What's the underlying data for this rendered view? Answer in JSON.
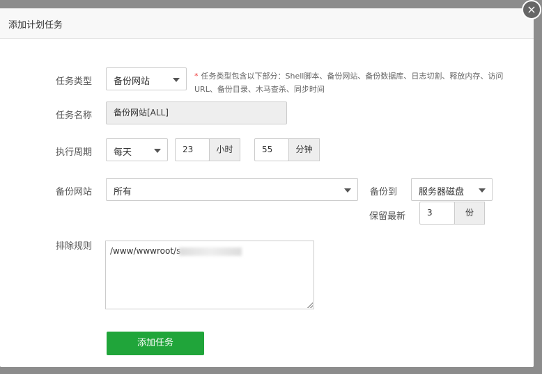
{
  "dialog": {
    "title": "添加计划任务",
    "close_symbol": "×"
  },
  "form": {
    "task_type": {
      "label": "任务类型",
      "selected": "备份网站",
      "hint": "任务类型包含以下部分：Shell脚本、备份网站、备份数据库、日志切割、释放内存、访问URL、备份目录、木马查杀、同步时间",
      "hint_mark": "*"
    },
    "task_name": {
      "label": "任务名称",
      "value": "备份网站[ALL]"
    },
    "period": {
      "label": "执行周期",
      "selected": "每天",
      "hour_value": "23",
      "hour_unit": "小时",
      "minute_value": "55",
      "minute_unit": "分钟"
    },
    "backup_site": {
      "label": "备份网站",
      "selected": "所有",
      "backup_to_label": "备份到",
      "backup_to_selected": "服务器磁盘",
      "keep_label": "保留最新",
      "keep_value": "3",
      "keep_unit": "份"
    },
    "exclude": {
      "label": "排除规则",
      "value": "/www/wwwroot/s"
    },
    "submit_label": "添加任务"
  },
  "colors": {
    "primary_button": "#20a53a",
    "required_mark": "#ee3333"
  }
}
